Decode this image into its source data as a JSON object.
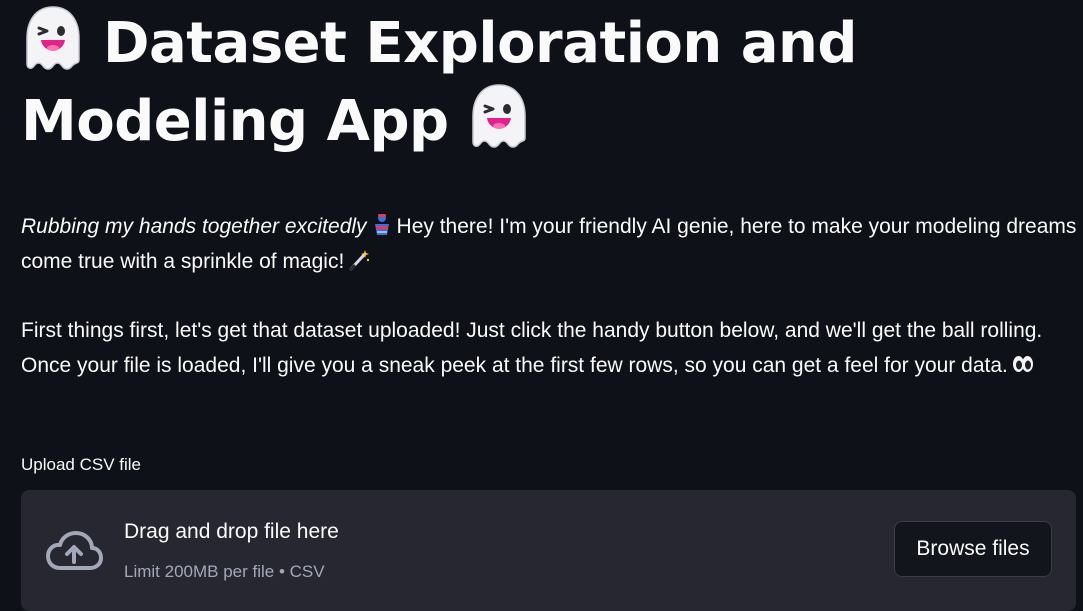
{
  "header": {
    "title_line1": "Dataset Exploration and",
    "title_line2": "Modeling App",
    "title_icon": "ghost-icon"
  },
  "intro": {
    "italic_text": "Rubbing my hands together excitedly",
    "genie_icon": "genie-icon",
    "text": "Hey there! I'm your friendly AI genie, here to make your modeling dreams come true with a sprinkle of magic!",
    "wand_icon": "magic-wand-icon"
  },
  "instructions": {
    "text": "First things first, let's get that dataset uploaded! Just click the handy button below, and we'll get the ball rolling. Once your file is loaded, I'll give you a sneak peek at the first few rows, so you can get a feel for your data.",
    "eyes_icon": "eyes-icon"
  },
  "uploader": {
    "label": "Upload CSV file",
    "drop_title": "Drag and drop file here",
    "limit": "Limit 200MB per file • CSV",
    "browse_label": "Browse files",
    "icon": "cloud-upload-icon"
  },
  "colors": {
    "background": "#0e1117",
    "dropzone": "#262730",
    "text": "#fafafa",
    "muted": "#a3a8b8",
    "ghost_mouth": "#e0238a"
  }
}
